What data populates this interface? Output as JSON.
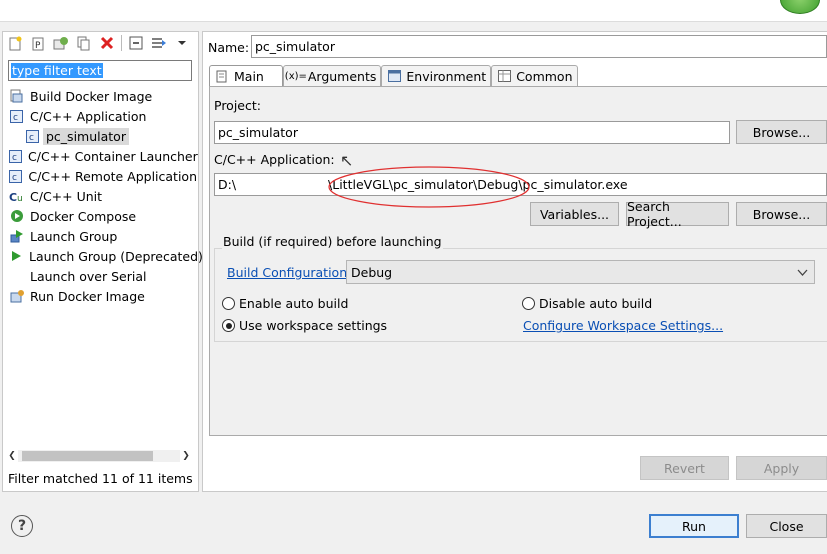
{
  "filter": {
    "placeholder": "type filter text"
  },
  "tree": {
    "items": [
      {
        "label": "Build Docker Image",
        "icon": "docker-build-icon"
      },
      {
        "label": "C/C++ Application",
        "icon": "c-app-icon"
      },
      {
        "label": "pc_simulator",
        "icon": "c-config-icon"
      },
      {
        "label": "C/C++ Container Launcher",
        "icon": "c-app-icon"
      },
      {
        "label": "C/C++ Remote Application",
        "icon": "c-app-icon"
      },
      {
        "label": "C/C++ Unit",
        "icon": "c-unit-icon"
      },
      {
        "label": "Docker Compose",
        "icon": "docker-compose-icon"
      },
      {
        "label": "Launch Group",
        "icon": "launch-group-icon"
      },
      {
        "label": "Launch Group (Deprecated)",
        "icon": "launch-group-deprecated-icon"
      },
      {
        "label": "Launch over Serial",
        "icon": "none"
      },
      {
        "label": "Run Docker Image",
        "icon": "docker-run-icon"
      }
    ],
    "status": "Filter matched 11 of 11 items"
  },
  "config": {
    "name_label": "Name:",
    "name_value": "pc_simulator",
    "tabs": [
      {
        "label": "Main"
      },
      {
        "label": "Arguments"
      },
      {
        "label": "Environment"
      },
      {
        "label": "Common"
      }
    ],
    "project_label": "Project:",
    "project_value": "pc_simulator",
    "browse_label": "Browse...",
    "app_label": "C/C++ Application:",
    "app_prefix": "D:\\",
    "app_value": "\\LittleVGL\\pc_simulator\\Debug\\pc_simulator.exe",
    "variables_label": "Variables...",
    "search_project_label": "Search Project...",
    "browse2_label": "Browse...",
    "build_group_title": "Build (if required) before launching",
    "build_config_label": "Build Configuration:",
    "build_config_value": "Debug",
    "enable_auto_build": "Enable auto build",
    "disable_auto_build": "Disable auto build",
    "use_workspace": "Use workspace settings",
    "configure_workspace": "Configure Workspace Settings...",
    "revert_label": "Revert",
    "apply_label": "Apply"
  },
  "footer": {
    "help": "?",
    "run_label": "Run",
    "close_label": "Close"
  },
  "colors": {
    "accent": "#3c7fd0",
    "link": "#0a4fb4",
    "annotation": "#e03030"
  }
}
